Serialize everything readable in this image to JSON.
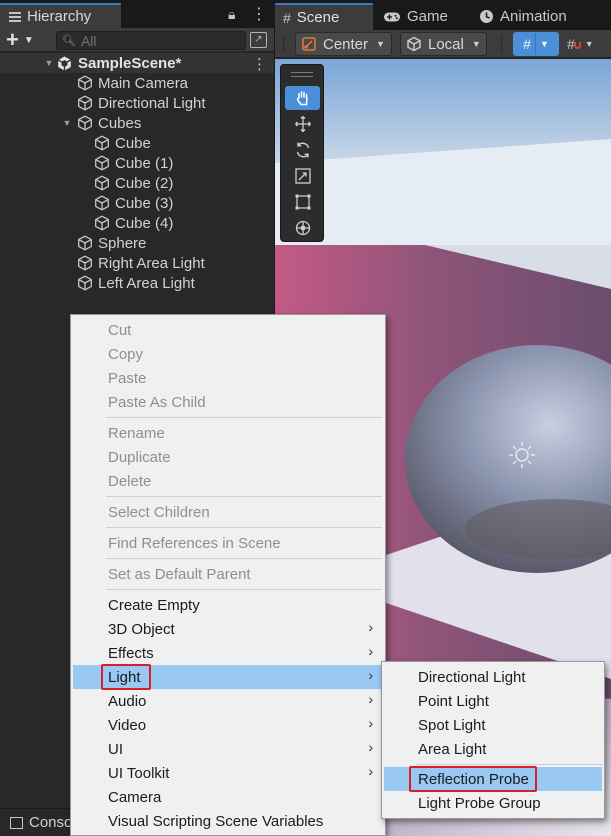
{
  "hierarchy": {
    "tab_label": "Hierarchy",
    "search_placeholder": "All",
    "scene_name": "SampleScene*",
    "objects": [
      {
        "label": "Main Camera"
      },
      {
        "label": "Directional Light"
      },
      {
        "label": "Cubes",
        "expanded": true
      },
      {
        "label": "Cube"
      },
      {
        "label": "Cube (1)"
      },
      {
        "label": "Cube (2)"
      },
      {
        "label": "Cube (3)"
      },
      {
        "label": "Cube (4)"
      },
      {
        "label": "Sphere"
      },
      {
        "label": "Right Area Light"
      },
      {
        "label": "Left Area Light"
      }
    ]
  },
  "console_tab": {
    "label": "Conso"
  },
  "scene_view": {
    "tabs": [
      {
        "label": "Scene",
        "icon": "grid-hash-icon",
        "active": true
      },
      {
        "label": "Game",
        "icon": "gamepad-icon"
      },
      {
        "label": "Animation",
        "icon": "clock-icon"
      }
    ],
    "pivot_mode": "Center",
    "pivot_space": "Local"
  },
  "context_menu": {
    "items": [
      {
        "label": "Cut",
        "enabled": false
      },
      {
        "label": "Copy",
        "enabled": false
      },
      {
        "label": "Paste",
        "enabled": false
      },
      {
        "label": "Paste As Child",
        "enabled": false
      },
      {
        "label": "Rename",
        "enabled": false
      },
      {
        "label": "Duplicate",
        "enabled": false
      },
      {
        "label": "Delete",
        "enabled": false
      },
      {
        "label": "Select Children",
        "enabled": false
      },
      {
        "label": "Find References in Scene",
        "enabled": false
      },
      {
        "label": "Set as Default Parent",
        "enabled": false
      },
      {
        "label": "Create Empty",
        "enabled": true
      },
      {
        "label": "3D Object",
        "enabled": true,
        "submenu": true
      },
      {
        "label": "Effects",
        "enabled": true,
        "submenu": true
      },
      {
        "label": "Light",
        "enabled": true,
        "submenu": true,
        "highlighted": true
      },
      {
        "label": "Audio",
        "enabled": true,
        "submenu": true
      },
      {
        "label": "Video",
        "enabled": true,
        "submenu": true
      },
      {
        "label": "UI",
        "enabled": true,
        "submenu": true
      },
      {
        "label": "UI Toolkit",
        "enabled": true,
        "submenu": true
      },
      {
        "label": "Camera",
        "enabled": true
      },
      {
        "label": "Visual Scripting Scene Variables",
        "enabled": true
      }
    ]
  },
  "light_submenu": {
    "items": [
      {
        "label": "Directional Light"
      },
      {
        "label": "Point Light"
      },
      {
        "label": "Spot Light"
      },
      {
        "label": "Area Light"
      },
      {
        "label": "Reflection Probe",
        "highlighted": true
      },
      {
        "label": "Light Probe Group"
      }
    ]
  },
  "colors": {
    "menu_highlight": "#99c9f3",
    "callout_red": "#d9202a",
    "tab_accent": "#3a79bb",
    "toggle_active": "#4a8fd8"
  }
}
